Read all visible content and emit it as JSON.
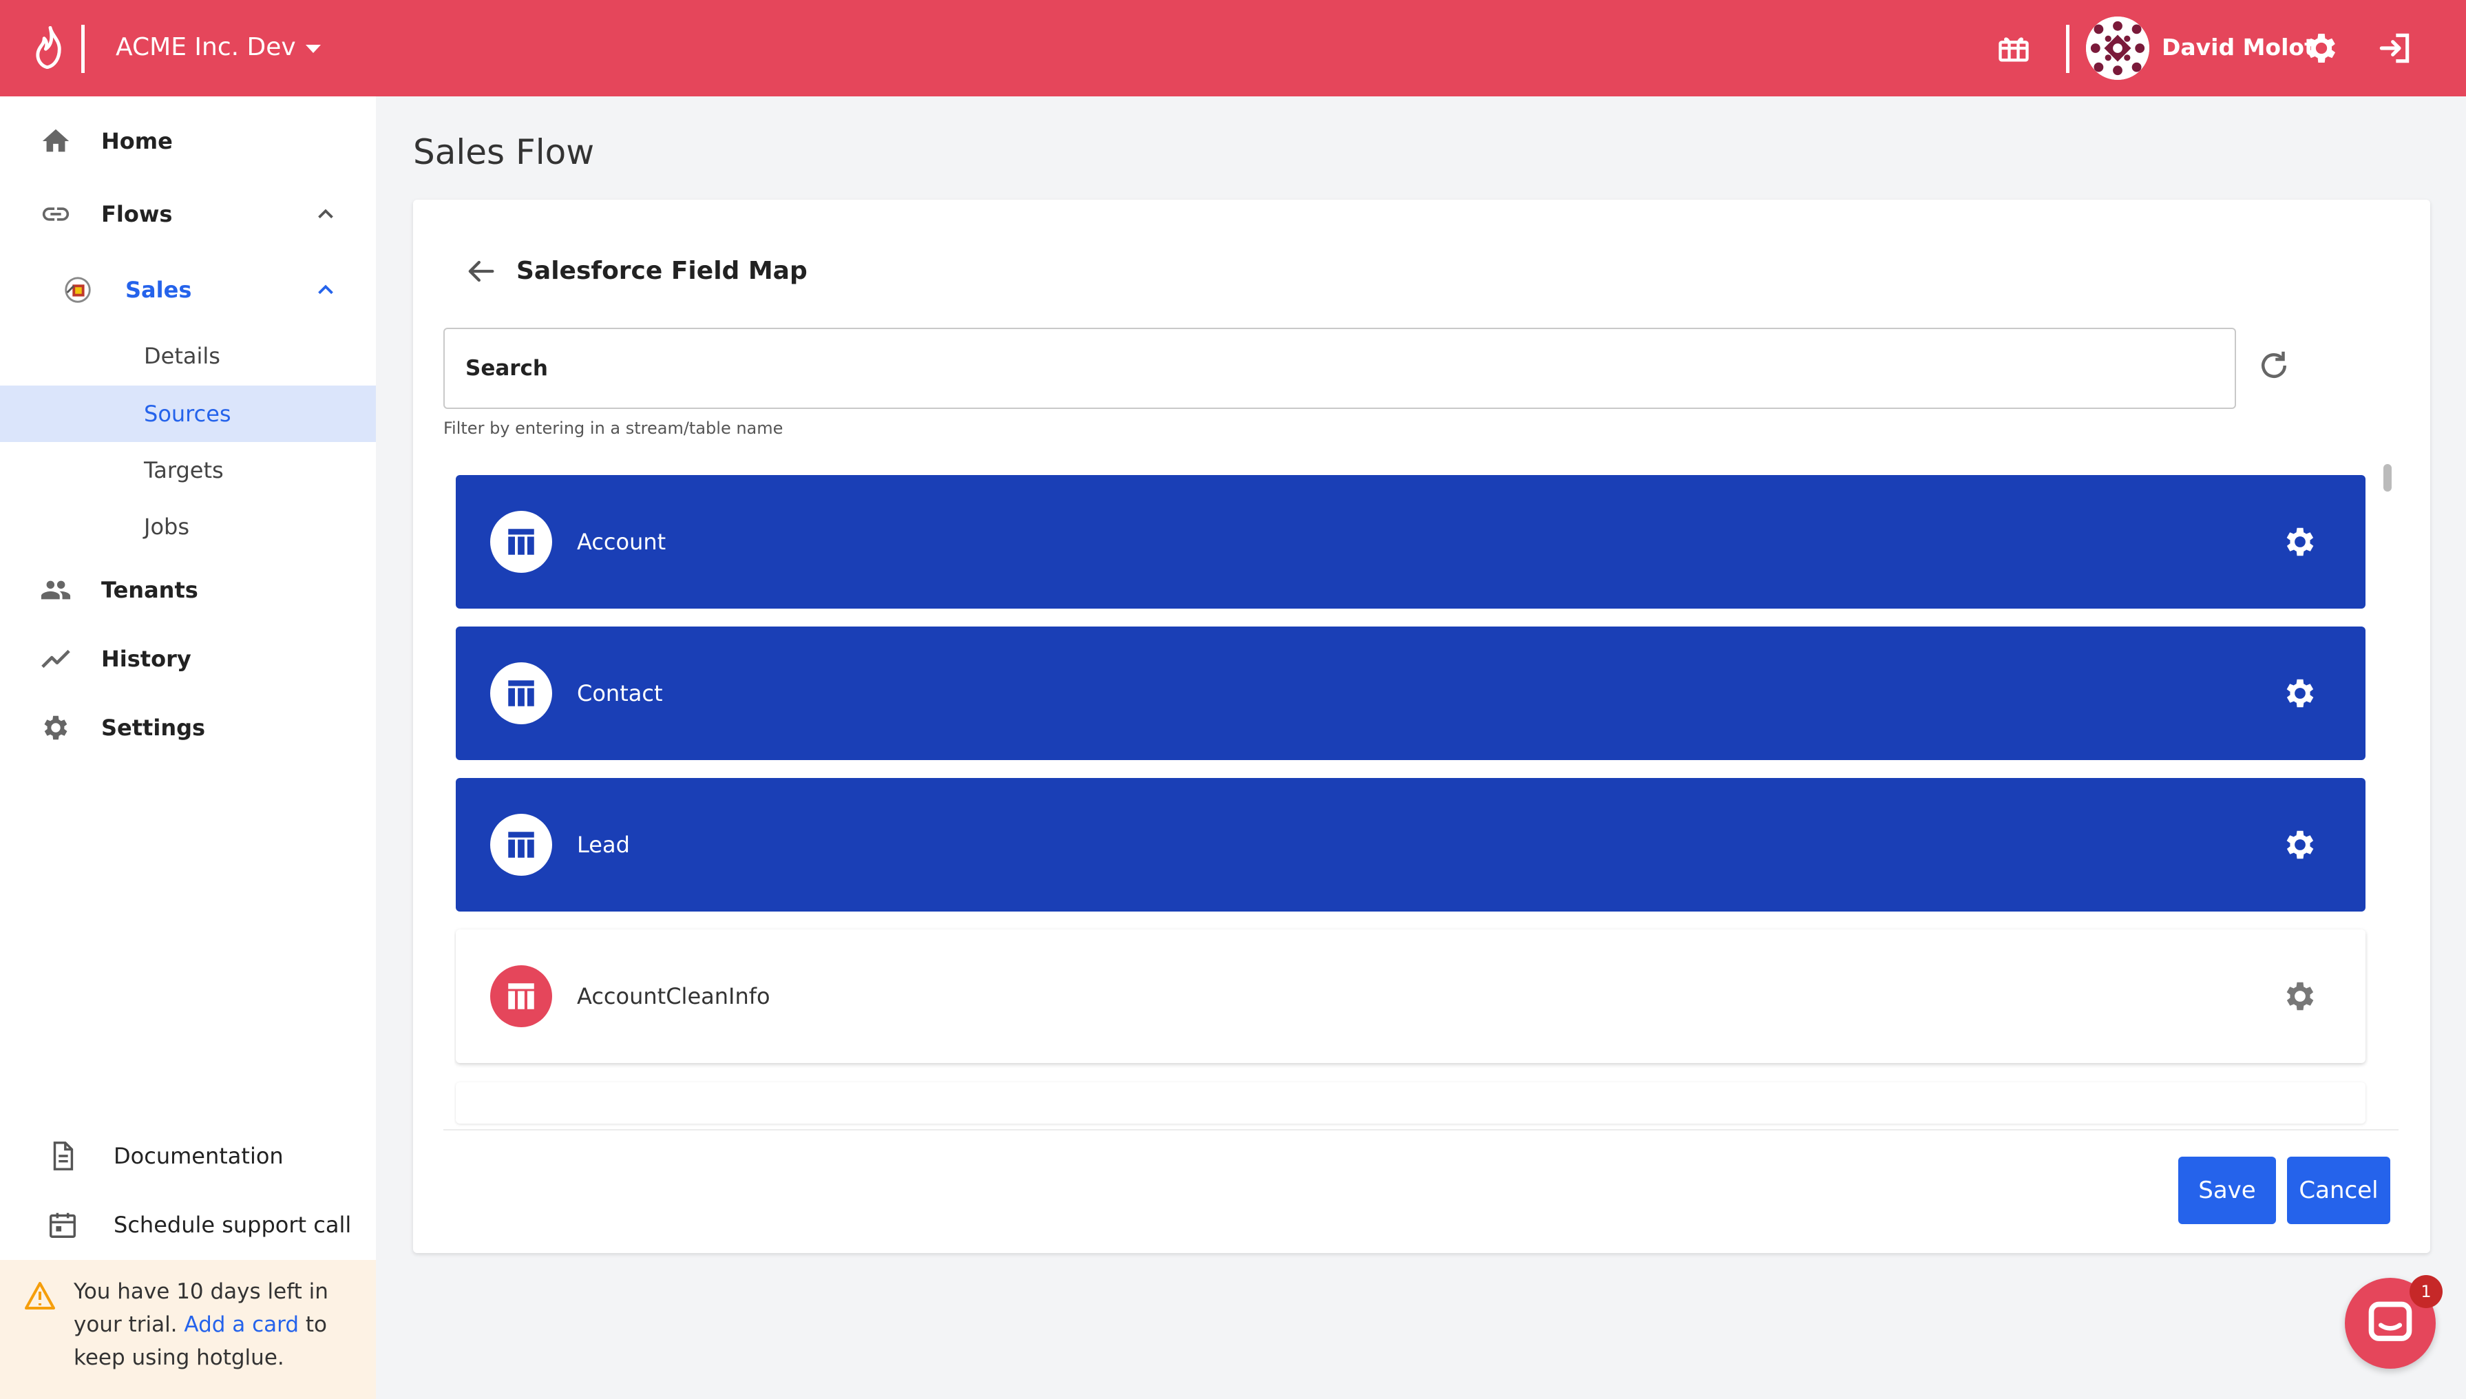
{
  "header": {
    "org_name": "ACME Inc. Dev",
    "user_name": "David Molot",
    "brand_color": "#e5465b",
    "icons": [
      "flame-logo-icon",
      "chevron-down-icon",
      "gift-icon",
      "avatar",
      "gear-icon",
      "logout-icon"
    ]
  },
  "sidebar": {
    "items": [
      {
        "label": "Home",
        "icon": "home-icon"
      },
      {
        "label": "Flows",
        "icon": "link-icon"
      },
      {
        "label": "Sales",
        "icon": "sales-flow-icon"
      },
      {
        "label": "Tenants",
        "icon": "people-icon"
      },
      {
        "label": "History",
        "icon": "trend-icon"
      },
      {
        "label": "Settings",
        "icon": "gear-icon"
      }
    ],
    "sub_items": [
      {
        "label": "Details"
      },
      {
        "label": "Sources",
        "active": true
      },
      {
        "label": "Targets"
      },
      {
        "label": "Jobs"
      }
    ],
    "bottom": [
      {
        "label": "Documentation",
        "icon": "document-icon"
      },
      {
        "label": "Schedule support call",
        "icon": "calendar-icon"
      }
    ],
    "trial": {
      "pre": "You have 10 days left in your trial.",
      "link": "Add a card",
      "post": "to keep using hotglue."
    }
  },
  "main": {
    "page_title": "Sales Flow",
    "card_title": "Salesforce Field Map",
    "search_placeholder": "Search",
    "helper_text": "Filter by entering in a stream/table name",
    "streams": [
      {
        "label": "Account",
        "selected": true
      },
      {
        "label": "Contact",
        "selected": true
      },
      {
        "label": "Lead",
        "selected": true
      },
      {
        "label": "AccountCleanInfo",
        "selected": false
      }
    ],
    "save_label": "Save",
    "cancel_label": "Cancel",
    "selected_color": "#1a3fb6",
    "button_color": "#2563eb"
  },
  "chat": {
    "badge": "1"
  }
}
